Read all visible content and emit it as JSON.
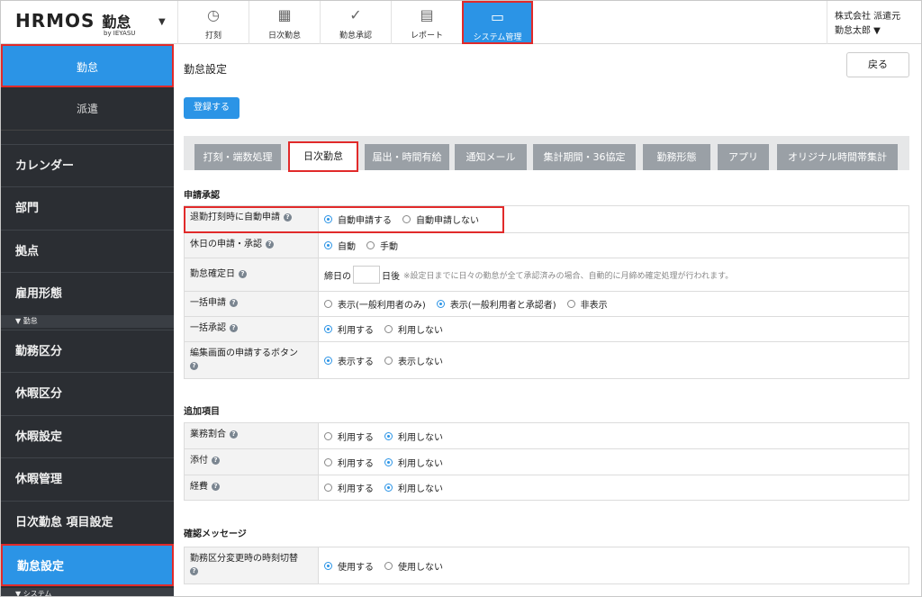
{
  "header": {
    "logo": "HRMOS",
    "logo_kintai": "勤怠",
    "logo_sub": "by IEYASU",
    "nav": [
      {
        "icon": "clock-icon",
        "glyph": "◷",
        "label": "打刻"
      },
      {
        "icon": "calendar-icon",
        "glyph": "▦",
        "label": "日次勤怠"
      },
      {
        "icon": "check-icon",
        "glyph": "✓",
        "label": "勤怠承認"
      },
      {
        "icon": "document-icon",
        "glyph": "▤",
        "label": "レポート"
      },
      {
        "icon": "monitor-icon",
        "glyph": "▭",
        "label": "システム管理"
      }
    ],
    "company": "株式会社 派遣元",
    "user": "勤怠太郎 ▼"
  },
  "sidebar": {
    "top": [
      "勤怠",
      "派遣"
    ],
    "items": [
      "カレンダー",
      "部門",
      "拠点",
      "雇用形態"
    ],
    "section1": "▼ 勤怠",
    "items2": [
      "勤務区分",
      "休暇区分",
      "休暇設定",
      "休暇管理",
      "日次勤怠 項目設定",
      "勤怠設定"
    ],
    "section2": "▼ システム"
  },
  "main": {
    "title": "勤怠設定",
    "back": "戻る",
    "register": "登録する",
    "tabs": [
      "打刻・端数処理",
      "日次勤怠",
      "届出・時間有給",
      "通知メール",
      "集計期間・36協定",
      "勤務形態",
      "アプリ",
      "オリジナル時間帯集計"
    ],
    "section_approval": "申請承認",
    "approval_rows": [
      {
        "label": "退勤打刻時に自動申請",
        "options": [
          "自動申請する",
          "自動申請しない"
        ]
      },
      {
        "label": "休日の申請・承認",
        "options": [
          "自動",
          "手動"
        ]
      },
      {
        "label": "勤怠確定日",
        "prefix": "締日の",
        "suffix": "日後",
        "note": "※設定日までに日々の勤怠が全て承認済みの場合、自動的に月締め確定処理が行われます。"
      },
      {
        "label": "一括申請",
        "options": [
          "表示(一般利用者のみ)",
          "表示(一般利用者と承認者)",
          "非表示"
        ]
      },
      {
        "label": "一括承認",
        "options": [
          "利用する",
          "利用しない"
        ]
      },
      {
        "label": "編集画面の申請するボタン",
        "options": [
          "表示する",
          "表示しない"
        ]
      }
    ],
    "section_additional": "追加項目",
    "additional_rows": [
      {
        "label": "業務割合",
        "options": [
          "利用する",
          "利用しない"
        ]
      },
      {
        "label": "添付",
        "options": [
          "利用する",
          "利用しない"
        ]
      },
      {
        "label": "経費",
        "options": [
          "利用する",
          "利用しない"
        ]
      }
    ],
    "section_confirm": "確認メッセージ",
    "confirm_rows": [
      {
        "label": "勤務区分変更時の時刻切替",
        "options": [
          "使用する",
          "使用しない"
        ]
      }
    ]
  },
  "colors": {
    "accent": "#2b94e6",
    "highlight": "#e12a2a",
    "sidebar": "#2b2e33"
  }
}
